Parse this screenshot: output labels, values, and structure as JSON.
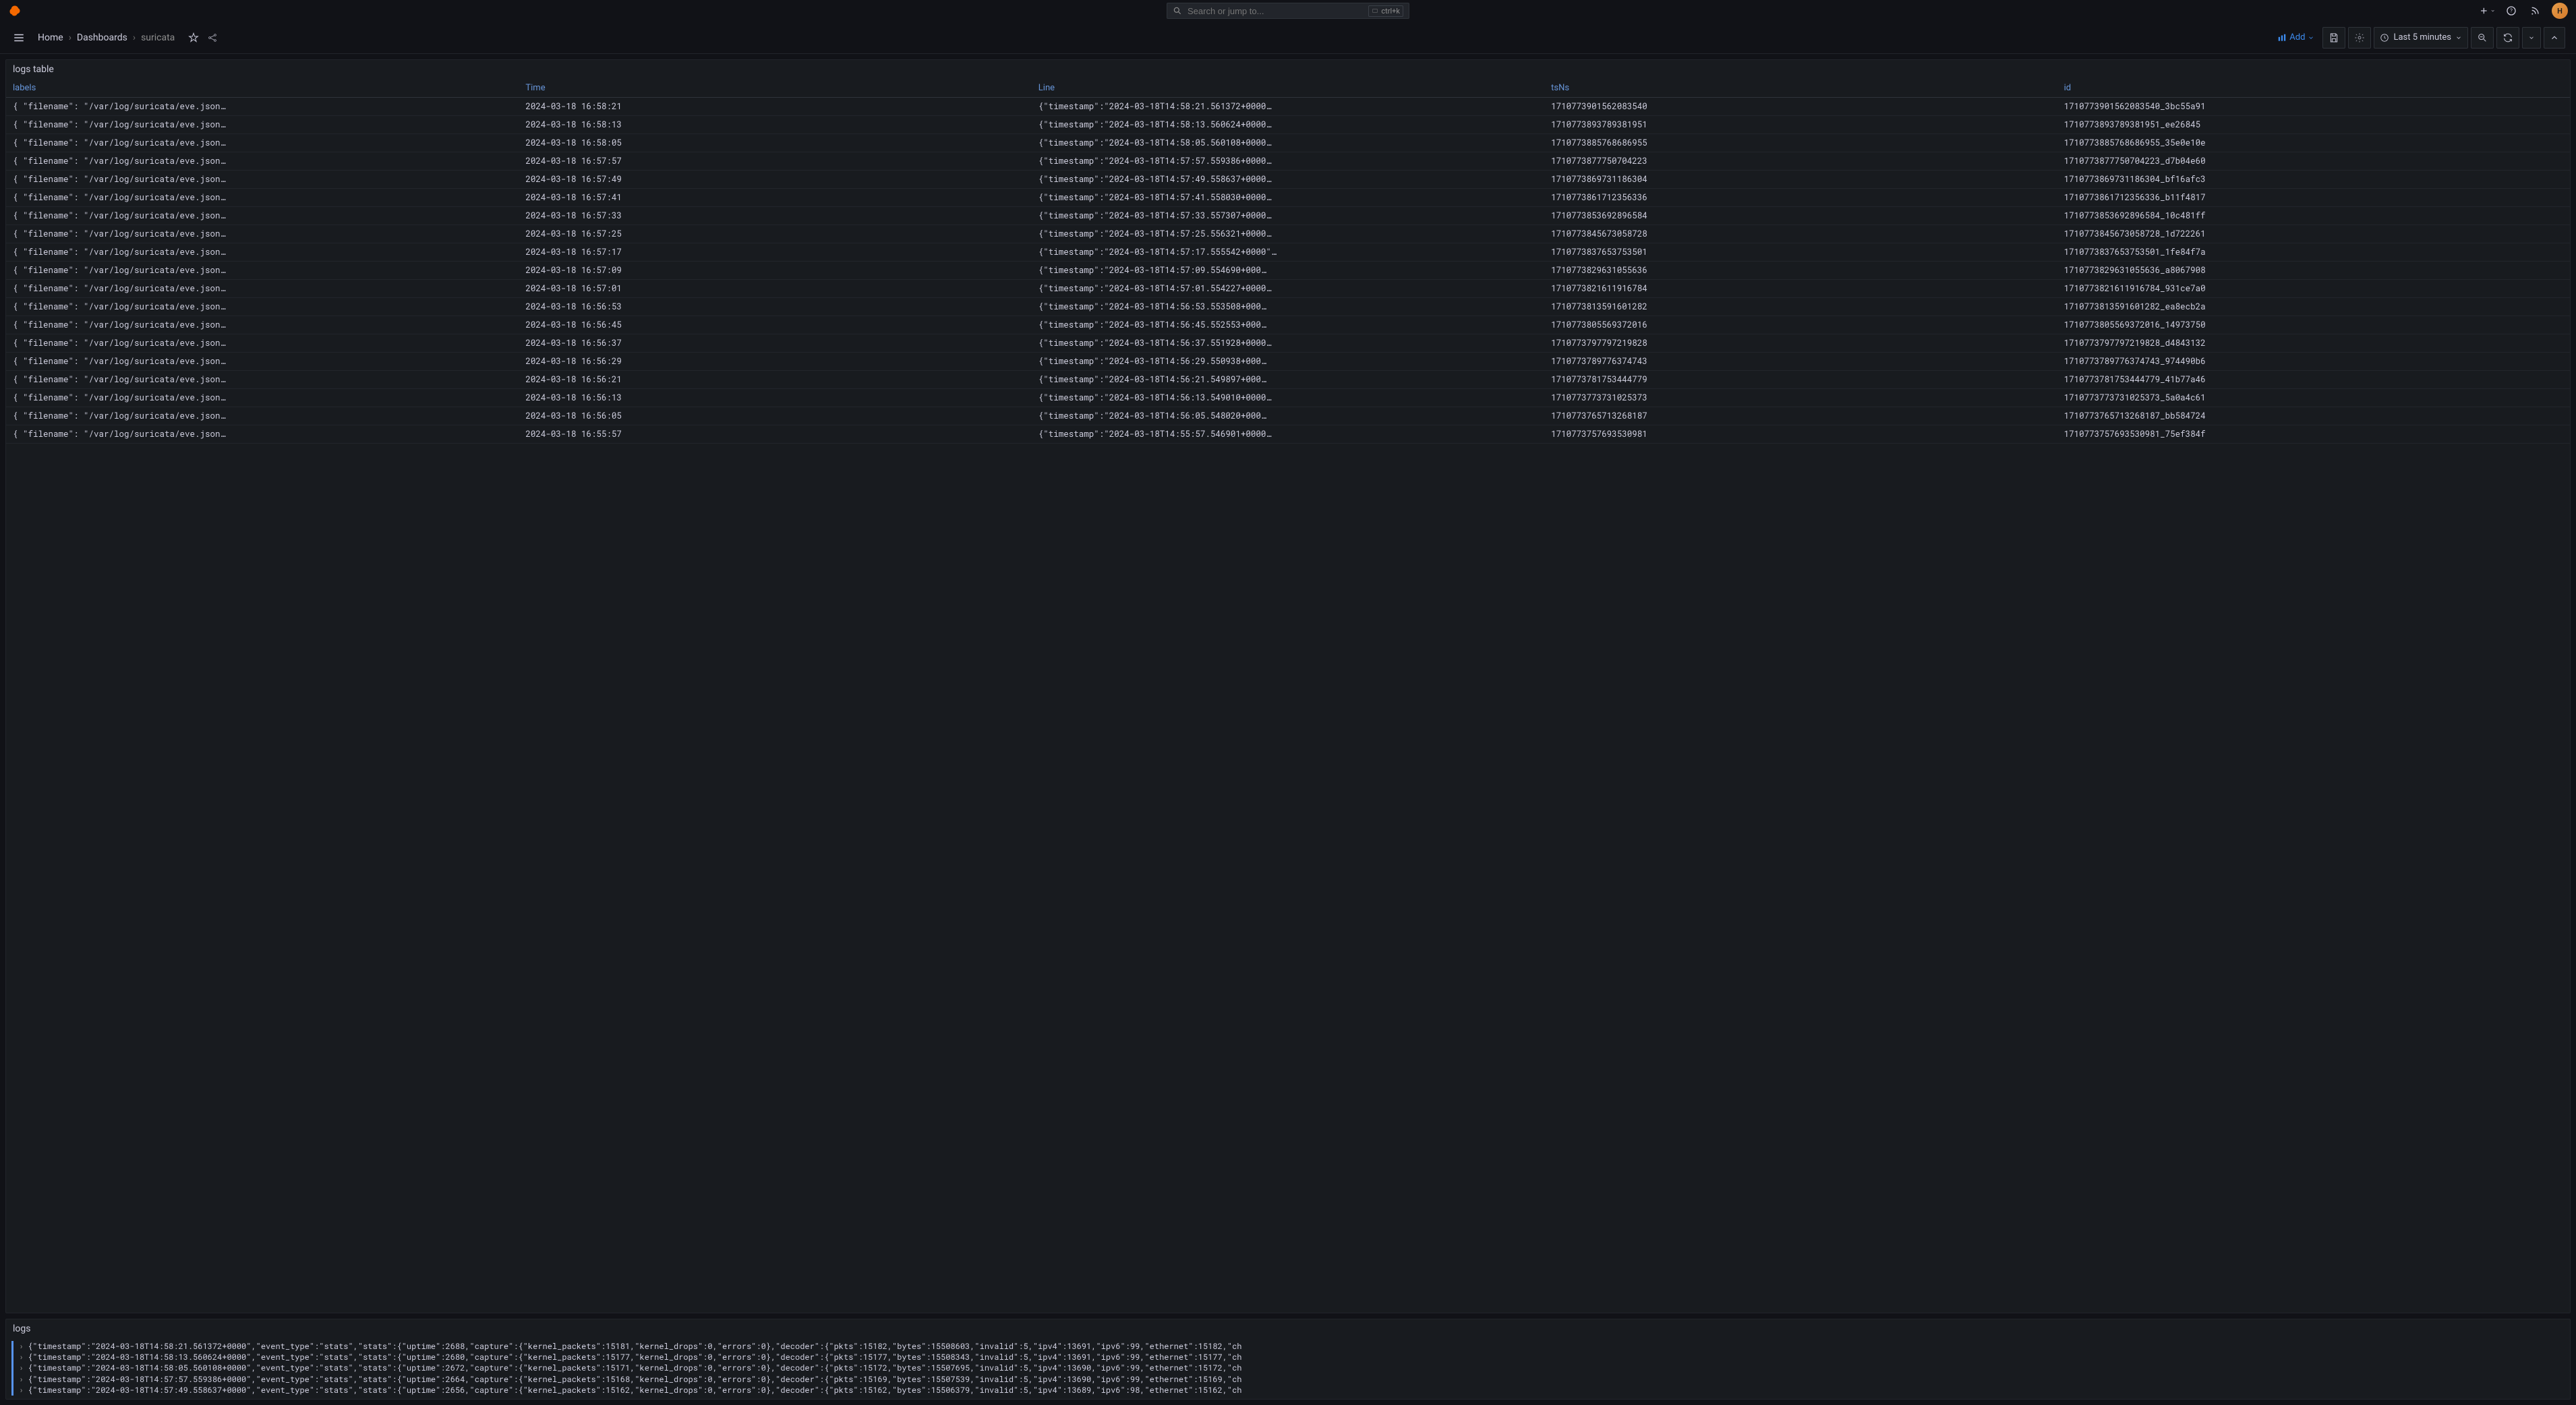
{
  "search": {
    "placeholder": "Search or jump to...",
    "shortcut": "ctrl+k"
  },
  "breadcrumbs": {
    "home": "Home",
    "dashboards": "Dashboards",
    "current": "suricata"
  },
  "toolbar": {
    "add": "Add",
    "time_label": "Last 5 minutes"
  },
  "panels": {
    "table": {
      "title": "logs table",
      "columns": [
        "labels",
        "Time",
        "Line",
        "tsNs",
        "id"
      ],
      "rows": [
        {
          "labels": "{ \"filename\": \"/var/log/suricata/eve.json…",
          "time": "2024-03-18 16:58:21",
          "line": "{\"timestamp\":\"2024-03-18T14:58:21.561372+0000…",
          "tsns": "1710773901562083540",
          "id": "1710773901562083540_3bc55a91"
        },
        {
          "labels": "{ \"filename\": \"/var/log/suricata/eve.json…",
          "time": "2024-03-18 16:58:13",
          "line": "{\"timestamp\":\"2024-03-18T14:58:13.560624+0000…",
          "tsns": "1710773893789381951",
          "id": "1710773893789381951_ee26845"
        },
        {
          "labels": "{ \"filename\": \"/var/log/suricata/eve.json…",
          "time": "2024-03-18 16:58:05",
          "line": "{\"timestamp\":\"2024-03-18T14:58:05.560108+0000…",
          "tsns": "1710773885768686955",
          "id": "1710773885768686955_35e0e10e"
        },
        {
          "labels": "{ \"filename\": \"/var/log/suricata/eve.json…",
          "time": "2024-03-18 16:57:57",
          "line": "{\"timestamp\":\"2024-03-18T14:57:57.559386+0000…",
          "tsns": "1710773877750704223",
          "id": "1710773877750704223_d7b04e60"
        },
        {
          "labels": "{ \"filename\": \"/var/log/suricata/eve.json…",
          "time": "2024-03-18 16:57:49",
          "line": "{\"timestamp\":\"2024-03-18T14:57:49.558637+0000…",
          "tsns": "1710773869731186304",
          "id": "1710773869731186304_bf16afc3"
        },
        {
          "labels": "{ \"filename\": \"/var/log/suricata/eve.json…",
          "time": "2024-03-18 16:57:41",
          "line": "{\"timestamp\":\"2024-03-18T14:57:41.558030+0000…",
          "tsns": "1710773861712356336",
          "id": "1710773861712356336_b11f4817"
        },
        {
          "labels": "{ \"filename\": \"/var/log/suricata/eve.json…",
          "time": "2024-03-18 16:57:33",
          "line": "{\"timestamp\":\"2024-03-18T14:57:33.557307+0000…",
          "tsns": "1710773853692896584",
          "id": "1710773853692896584_10c481ff"
        },
        {
          "labels": "{ \"filename\": \"/var/log/suricata/eve.json…",
          "time": "2024-03-18 16:57:25",
          "line": "{\"timestamp\":\"2024-03-18T14:57:25.556321+0000…",
          "tsns": "1710773845673058728",
          "id": "1710773845673058728_1d722261"
        },
        {
          "labels": "{ \"filename\": \"/var/log/suricata/eve.json…",
          "time": "2024-03-18 16:57:17",
          "line": "{\"timestamp\":\"2024-03-18T14:57:17.555542+0000\"…",
          "tsns": "1710773837653753501",
          "id": "1710773837653753501_1fe84f7a"
        },
        {
          "labels": "{ \"filename\": \"/var/log/suricata/eve.json…",
          "time": "2024-03-18 16:57:09",
          "line": "{\"timestamp\":\"2024-03-18T14:57:09.554690+000…",
          "tsns": "1710773829631055636",
          "id": "1710773829631055636_a8067908"
        },
        {
          "labels": "{ \"filename\": \"/var/log/suricata/eve.json…",
          "time": "2024-03-18 16:57:01",
          "line": "{\"timestamp\":\"2024-03-18T14:57:01.554227+0000…",
          "tsns": "1710773821611916784",
          "id": "1710773821611916784_931ce7a0"
        },
        {
          "labels": "{ \"filename\": \"/var/log/suricata/eve.json…",
          "time": "2024-03-18 16:56:53",
          "line": "{\"timestamp\":\"2024-03-18T14:56:53.553508+000…",
          "tsns": "1710773813591601282",
          "id": "1710773813591601282_ea8ecb2a"
        },
        {
          "labels": "{ \"filename\": \"/var/log/suricata/eve.json…",
          "time": "2024-03-18 16:56:45",
          "line": "{\"timestamp\":\"2024-03-18T14:56:45.552553+000…",
          "tsns": "1710773805569372016",
          "id": "1710773805569372016_14973750"
        },
        {
          "labels": "{ \"filename\": \"/var/log/suricata/eve.json…",
          "time": "2024-03-18 16:56:37",
          "line": "{\"timestamp\":\"2024-03-18T14:56:37.551928+0000…",
          "tsns": "1710773797797219828",
          "id": "1710773797797219828_d4843132"
        },
        {
          "labels": "{ \"filename\": \"/var/log/suricata/eve.json…",
          "time": "2024-03-18 16:56:29",
          "line": "{\"timestamp\":\"2024-03-18T14:56:29.550938+000…",
          "tsns": "1710773789776374743",
          "id": "1710773789776374743_974490b6"
        },
        {
          "labels": "{ \"filename\": \"/var/log/suricata/eve.json…",
          "time": "2024-03-18 16:56:21",
          "line": "{\"timestamp\":\"2024-03-18T14:56:21.549897+000…",
          "tsns": "1710773781753444779",
          "id": "1710773781753444779_41b77a46"
        },
        {
          "labels": "{ \"filename\": \"/var/log/suricata/eve.json…",
          "time": "2024-03-18 16:56:13",
          "line": "{\"timestamp\":\"2024-03-18T14:56:13.549010+0000…",
          "tsns": "1710773773731025373",
          "id": "1710773773731025373_5a0a4c61"
        },
        {
          "labels": "{ \"filename\": \"/var/log/suricata/eve.json…",
          "time": "2024-03-18 16:56:05",
          "line": "{\"timestamp\":\"2024-03-18T14:56:05.548020+000…",
          "tsns": "1710773765713268187",
          "id": "1710773765713268187_bb584724"
        },
        {
          "labels": "{ \"filename\": \"/var/log/suricata/eve.json…",
          "time": "2024-03-18 16:55:57",
          "line": "{\"timestamp\":\"2024-03-18T14:55:57.546901+0000…",
          "tsns": "1710773757693530981",
          "id": "1710773757693530981_75ef384f"
        }
      ]
    },
    "logs": {
      "title": "logs",
      "lines": [
        "{\"timestamp\":\"2024-03-18T14:58:21.561372+0000\",\"event_type\":\"stats\",\"stats\":{\"uptime\":2688,\"capture\":{\"kernel_packets\":15181,\"kernel_drops\":0,\"errors\":0},\"decoder\":{\"pkts\":15182,\"bytes\":15508603,\"invalid\":5,\"ipv4\":13691,\"ipv6\":99,\"ethernet\":15182,\"ch",
        "{\"timestamp\":\"2024-03-18T14:58:13.560624+0000\",\"event_type\":\"stats\",\"stats\":{\"uptime\":2680,\"capture\":{\"kernel_packets\":15177,\"kernel_drops\":0,\"errors\":0},\"decoder\":{\"pkts\":15177,\"bytes\":15508343,\"invalid\":5,\"ipv4\":13691,\"ipv6\":99,\"ethernet\":15177,\"ch",
        "{\"timestamp\":\"2024-03-18T14:58:05.560108+0000\",\"event_type\":\"stats\",\"stats\":{\"uptime\":2672,\"capture\":{\"kernel_packets\":15171,\"kernel_drops\":0,\"errors\":0},\"decoder\":{\"pkts\":15172,\"bytes\":15507695,\"invalid\":5,\"ipv4\":13690,\"ipv6\":99,\"ethernet\":15172,\"ch",
        "{\"timestamp\":\"2024-03-18T14:57:57.559386+0000\",\"event_type\":\"stats\",\"stats\":{\"uptime\":2664,\"capture\":{\"kernel_packets\":15168,\"kernel_drops\":0,\"errors\":0},\"decoder\":{\"pkts\":15169,\"bytes\":15507539,\"invalid\":5,\"ipv4\":13690,\"ipv6\":99,\"ethernet\":15169,\"ch",
        "{\"timestamp\":\"2024-03-18T14:57:49.558637+0000\",\"event_type\":\"stats\",\"stats\":{\"uptime\":2656,\"capture\":{\"kernel_packets\":15162,\"kernel_drops\":0,\"errors\":0},\"decoder\":{\"pkts\":15162,\"bytes\":15506379,\"invalid\":5,\"ipv4\":13689,\"ipv6\":98,\"ethernet\":15162,\"ch"
      ]
    }
  }
}
